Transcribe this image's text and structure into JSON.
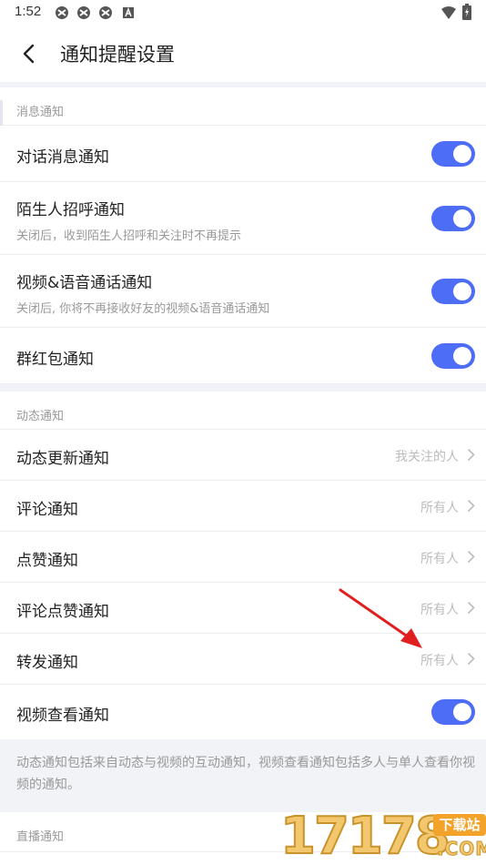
{
  "status_bar": {
    "time": "1:52",
    "icons": [
      "app-icon",
      "app-icon",
      "app-icon",
      "notification-a-icon",
      "wifi-icon",
      "battery-icon"
    ]
  },
  "app_bar": {
    "title": "通知提醒设置",
    "back_icon": "chevron-left-icon"
  },
  "sections": {
    "message": {
      "header": "消息通知",
      "items": [
        {
          "label": "对话消息通知",
          "toggle": true
        },
        {
          "label": "陌生人招呼通知",
          "sub": "关闭后，收到陌生人招呼和关注时不再提示",
          "toggle": true
        },
        {
          "label": "视频&语音通话通知",
          "sub": "关闭后, 你将不再接收好友的视频&语音通话通知",
          "toggle": true
        },
        {
          "label": "群红包通知",
          "toggle": true
        }
      ]
    },
    "dynamic": {
      "header": "动态通知",
      "items": [
        {
          "label": "动态更新通知",
          "value": "我关注的人"
        },
        {
          "label": "评论通知",
          "value": "所有人"
        },
        {
          "label": "点赞通知",
          "value": "所有人"
        },
        {
          "label": "评论点赞通知",
          "value": "所有人"
        },
        {
          "label": "转发通知",
          "value": "所有人"
        },
        {
          "label": "视频查看通知",
          "toggle": true
        }
      ],
      "note": "动态通知包括来自动态与视频的互动通知，视频查看通知包括多人与单人查看你视频的通知。"
    },
    "live": {
      "header": "直播通知"
    }
  },
  "colors": {
    "toggle_on": "#4e6df6",
    "annotation_arrow": "#e02020",
    "background": "#f2f3f7"
  },
  "watermark": {
    "digits": "17178",
    "badge": "下载站",
    "suffix": ".COM"
  }
}
